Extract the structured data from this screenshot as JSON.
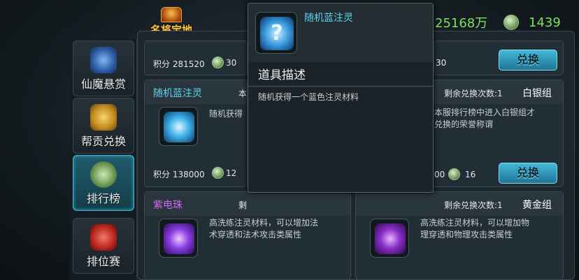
{
  "header": {
    "title": "名将宝地",
    "currency_1": "25168万",
    "currency_2": "1439"
  },
  "sidebar": {
    "items": [
      {
        "label": "仙魔悬赏"
      },
      {
        "label": "帮贡兑换"
      },
      {
        "label": "排行榜"
      },
      {
        "label": "排位赛"
      }
    ]
  },
  "cards": {
    "top_left": {
      "points": "积分 281520",
      "cost": "30"
    },
    "top_right": {
      "cost": "30",
      "button": "兑换"
    },
    "mid_left": {
      "name": "随机蓝注灵",
      "name_trunc": "本",
      "desc": "随机获得",
      "points": "积分 138000",
      "cost": "12"
    },
    "mid_right": {
      "remaining": "剩余兑换次数:1",
      "group": "白银组",
      "desc_line1": "本服排行榜中进入白银组才",
      "desc_line2": "兑换的荣誉称谓",
      "points_tail": "00",
      "cost": "16",
      "button": "兑换"
    },
    "bottom_left": {
      "name": "紫电珠",
      "name_trunc": "剩",
      "desc_line1": "高洗练注灵材料，可以增加法",
      "desc_line2": "术穿透和法术攻击类属性"
    },
    "bottom_right": {
      "remaining": "剩余兑换次数:1",
      "group": "黄金组",
      "desc_line1": "高洗练注灵材料，可以增加物",
      "desc_line2": "理穿透和物理攻击类属性"
    }
  },
  "popup": {
    "item_name": "随机蓝注灵",
    "section_title": "道具描述",
    "description": "随机获得一个蓝色注灵材料"
  }
}
